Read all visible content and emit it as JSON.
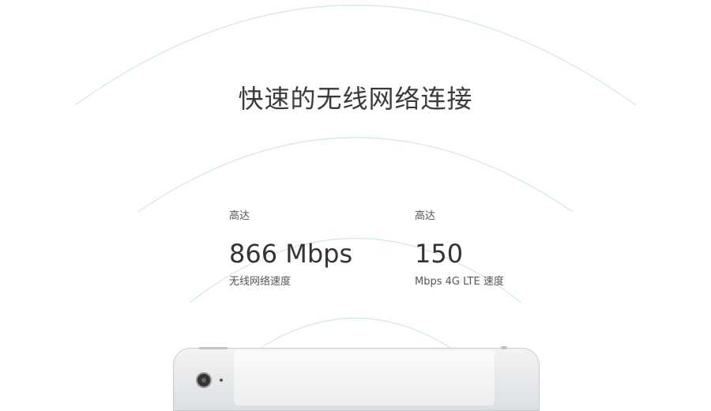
{
  "title": "快速的无线网络连接",
  "stats": [
    {
      "prefix": "高达",
      "value": "866 Mbps",
      "description": "无线网络速度"
    },
    {
      "prefix": "高达",
      "value": "150",
      "description": "Mbps 4G LTE 速度"
    }
  ],
  "colors": {
    "arc": "#cfe7ec",
    "title": "#3a3a3a",
    "text": "#333333"
  }
}
